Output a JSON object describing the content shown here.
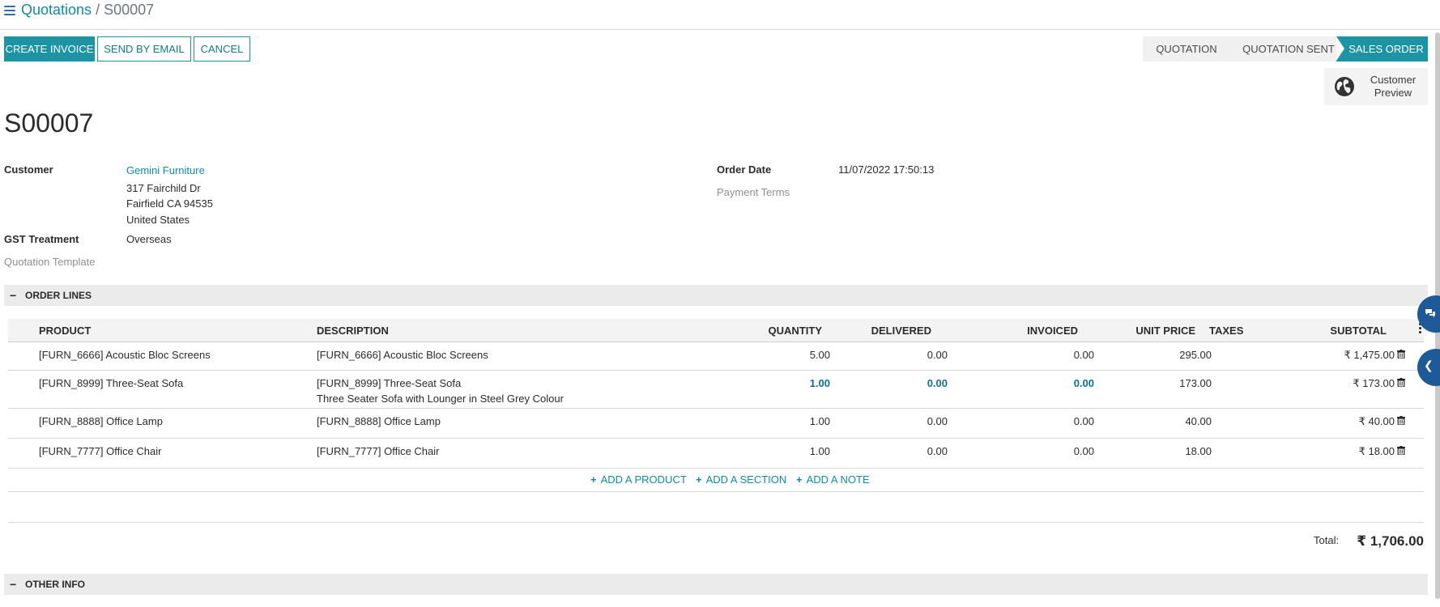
{
  "breadcrumb": {
    "parent": "Quotations",
    "separator": " / ",
    "current": "S00007"
  },
  "actions": {
    "create_invoice": "CREATE INVOICE",
    "send_by_email": "SEND BY EMAIL",
    "cancel": "CANCEL"
  },
  "status_bar": [
    {
      "label": "QUOTATION",
      "active": false
    },
    {
      "label": "QUOTATION SENT",
      "active": false
    },
    {
      "label": "SALES ORDER",
      "active": true
    }
  ],
  "customer_preview": {
    "line1": "Customer",
    "line2": "Preview",
    "icon": "globe-icon"
  },
  "document_title": "S00007",
  "fields": {
    "customer_label": "Customer",
    "customer_name": "Gemini Furniture",
    "address_line1": "317 Fairchild Dr",
    "address_line2": "Fairfield CA 94535",
    "address_line3": "United States",
    "gst_label": "GST Treatment",
    "gst_value": "Overseas",
    "template_label": "Quotation Template",
    "order_date_label": "Order Date",
    "order_date_value": "11/07/2022 17:50:13",
    "payment_terms_label": "Payment Terms"
  },
  "sections": {
    "order_lines": "ORDER LINES",
    "other_info": "OTHER INFO"
  },
  "table": {
    "headers": {
      "product": "PRODUCT",
      "description": "DESCRIPTION",
      "quantity": "QUANTITY",
      "delivered": "DELIVERED",
      "invoiced": "INVOICED",
      "unit_price": "UNIT PRICE",
      "taxes": "TAXES",
      "subtotal": "SUBTOTAL"
    },
    "rows": [
      {
        "product": "[FURN_6666] Acoustic Bloc Screens",
        "description": "[FURN_6666] Acoustic Bloc Screens",
        "description2": "",
        "quantity": "5.00",
        "delivered": "0.00",
        "invoiced": "0.00",
        "unit_price": "295.00",
        "taxes": "",
        "subtotal": "₹ 1,475.00"
      },
      {
        "product": "[FURN_8999] Three-Seat Sofa",
        "description": "[FURN_8999] Three-Seat Sofa",
        "description2": "Three Seater Sofa with Lounger in Steel Grey Colour",
        "quantity": "1.00",
        "delivered": "0.00",
        "invoiced": "0.00",
        "unit_price": "173.00",
        "taxes": "",
        "subtotal": "₹ 173.00"
      },
      {
        "product": "[FURN_8888] Office Lamp",
        "description": "[FURN_8888] Office Lamp",
        "description2": "",
        "quantity": "1.00",
        "delivered": "0.00",
        "invoiced": "0.00",
        "unit_price": "40.00",
        "taxes": "",
        "subtotal": "₹ 40.00"
      },
      {
        "product": "[FURN_7777] Office Chair",
        "description": "[FURN_7777] Office Chair",
        "description2": "",
        "quantity": "1.00",
        "delivered": "0.00",
        "invoiced": "0.00",
        "unit_price": "18.00",
        "taxes": "",
        "subtotal": "₹ 18.00"
      }
    ]
  },
  "add_links": {
    "product": "ADD A PRODUCT",
    "section": "ADD A SECTION",
    "note": "ADD A NOTE"
  },
  "total": {
    "label": "Total:",
    "value": "₹ 1,706.00"
  },
  "colors": {
    "accent": "#1c94a4",
    "link": "#0f8ba0",
    "side_button": "#1d5a97"
  }
}
